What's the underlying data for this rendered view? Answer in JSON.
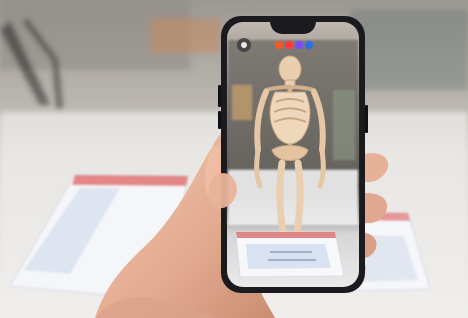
{
  "scene": {
    "subject": "hand-holding-phone",
    "phone_app": {
      "top_left_icon": "settings-icon",
      "top_color_dots": [
        "#f15a2a",
        "#ff3a3a",
        "#7c4dff",
        "#2f6fe0"
      ],
      "ar_model": "skeleton"
    }
  },
  "colors": {
    "background_table": "#e8e6e2",
    "background_wall": "#b9b6b0",
    "phone_body": "#1b1b1f",
    "skin": "#e8b79c",
    "bone": "#e9cfb0"
  }
}
